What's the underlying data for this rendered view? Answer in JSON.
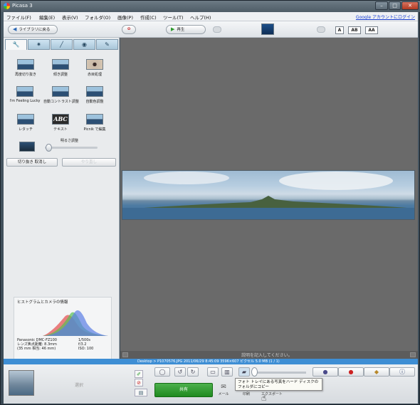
{
  "window": {
    "title": "Picasa 3",
    "minimize": "–",
    "maximize": "□",
    "close": "✕"
  },
  "menubar": {
    "items": [
      "ファイル(F)",
      "編集(E)",
      "表示(V)",
      "フォルダ(O)",
      "画像(P)",
      "作成(C)",
      "ツール(T)",
      "ヘルプ(H)"
    ],
    "account_link": "Google アカウントにログイン"
  },
  "toolbar": {
    "back_label": "ライブラリに戻る",
    "play_label": "再生",
    "text_sizes": [
      "A",
      "AB",
      "AA"
    ]
  },
  "left_panel": {
    "tabs": [
      "wrench-icon",
      "sun-icon",
      "brush-icon",
      "bucket-icon",
      "pen-icon"
    ],
    "tools": [
      "再度切り抜き",
      "傾き調整",
      "赤目処理",
      "I'm Feeling Lucky",
      "自動コントラスト調整",
      "自動色調整",
      "レタッチ",
      "テキスト",
      "Picnik で編集"
    ],
    "text_tool_glyph": "ABC",
    "brightness_label": "明るさ調整",
    "brightness_level": 0.05,
    "undo_crop_label": "切り抜き 取消し",
    "redo_label": "やり直し",
    "histogram": {
      "title": "ヒストグラムとカメラの情報",
      "camera": "Panasonic DMC-FZ100",
      "focal_label": "レンズ焦点距離: 8.3mm",
      "equiv_label": "(35 mm 相当: 46 mm)",
      "shutter": "1/500s",
      "aperture": "f/3.2",
      "iso": "ISO: 100"
    }
  },
  "viewer": {
    "caption_placeholder": "説明を記入してください。"
  },
  "status": {
    "text": "Desktop > P1070576.JPG 2011/06/29 8:45:09 3596×607 ピクセル 5.0 MB   (1 / 1)"
  },
  "tray": {
    "selection_label": "選択",
    "share_label": "共有",
    "actions": [
      "メール",
      "印刷",
      "エクスポート"
    ],
    "zoom_level": 0.05
  },
  "tooltip": {
    "text": "フォト トレイにある写真をハード ディスクのフォルダにコピー"
  },
  "colors": {
    "status_bar": "#3e8ed4",
    "share_button": "#1f8a1f",
    "viewer_bg": "#6a6a6a"
  }
}
